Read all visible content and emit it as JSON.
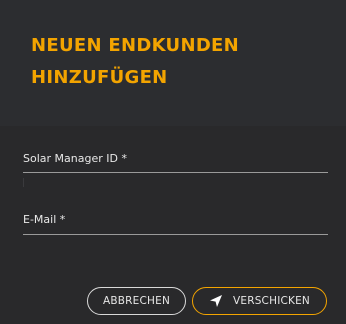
{
  "dialog": {
    "title_line1": "NEUEN ENDKUNDEN",
    "title_line2": "HINZUFÜGEN"
  },
  "form": {
    "solar_manager_id_label": "Solar Manager ID *",
    "email_label": "E-Mail *"
  },
  "actions": {
    "cancel_label": "ABBRECHEN",
    "send_label": "VERSCHICKEN",
    "send_icon": "paper-plane-icon"
  },
  "colors": {
    "accent": "#f3a400",
    "background": "#2a2a2c",
    "header_background": "#2c2d30"
  }
}
